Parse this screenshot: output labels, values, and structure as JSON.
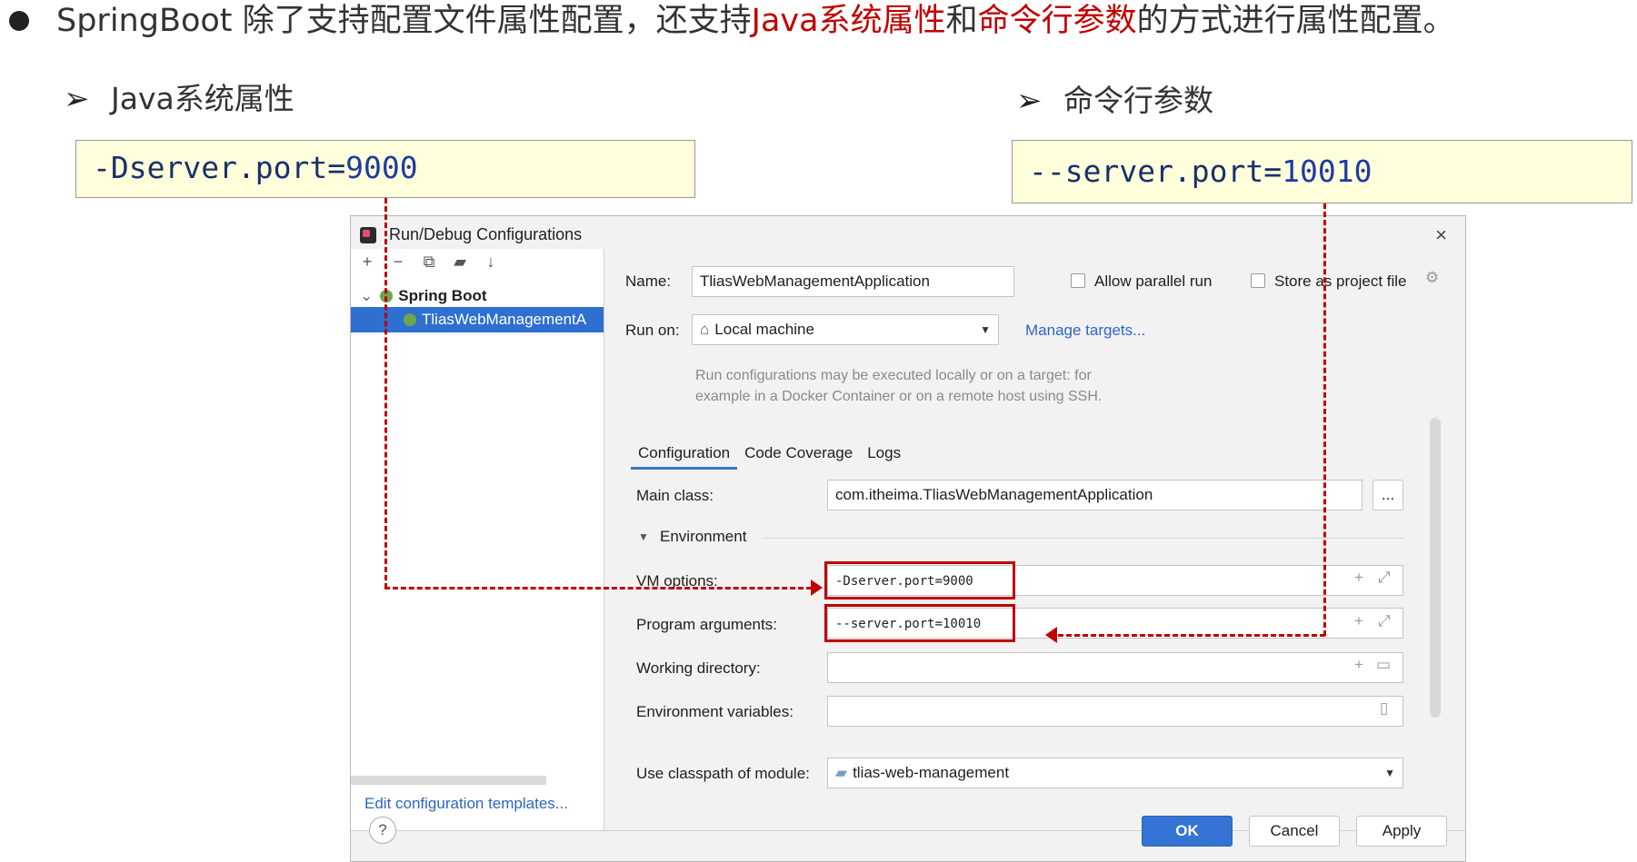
{
  "slide": {
    "headline_part1": "SpringBoot 除了支持配置文件属性配置，还支持",
    "headline_red1": "Java系统属性",
    "headline_mid": "和",
    "headline_red2": "命令行参数",
    "headline_part2": "的方式进行属性配置。",
    "left_section": {
      "bullet": "➢",
      "title": "Java系统属性",
      "code_prefix": "-Dserver.port=",
      "code_num": "9000"
    },
    "right_section": {
      "bullet": "➢",
      "title": "命令行参数",
      "code_prefix": "--server.port=",
      "code_num": "10010"
    },
    "accent_color": "#c00000"
  },
  "dialog": {
    "title": "Run/Debug Configurations",
    "close": "×",
    "toolbar": [
      "+",
      "−",
      "⧉",
      "▰",
      "↓"
    ],
    "tree": {
      "group_label": "Spring Boot",
      "item_label": "TliasWebManagementA"
    },
    "edit_templates": "Edit configuration templates...",
    "name_label": "Name:",
    "name_value": "TliasWebManagementApplication",
    "allow_parallel": "Allow parallel run",
    "store_project": "Store as project file",
    "run_on_label": "Run on:",
    "run_on_value": "Local machine",
    "manage_targets": "Manage targets...",
    "run_hint_1": "Run configurations may be executed locally or on a target: for",
    "run_hint_2": "example in a Docker Container or on a remote host using SSH.",
    "tabs": [
      "Configuration",
      "Code Coverage",
      "Logs"
    ],
    "main_class_label": "Main class:",
    "main_class_value": "com.itheima.TliasWebManagementApplication",
    "browse": "...",
    "environment": "Environment",
    "vm_options_label": "VM options:",
    "vm_options_value": "-Dserver.port=9000",
    "program_args_label": "Program arguments:",
    "program_args_value": "--server.port=10010",
    "working_dir_label": "Working directory:",
    "env_vars_label": "Environment variables:",
    "classpath_label": "Use classpath of module:",
    "classpath_value": "tlias-web-management",
    "help": "?",
    "ok": "OK",
    "cancel": "Cancel",
    "apply": "Apply"
  }
}
